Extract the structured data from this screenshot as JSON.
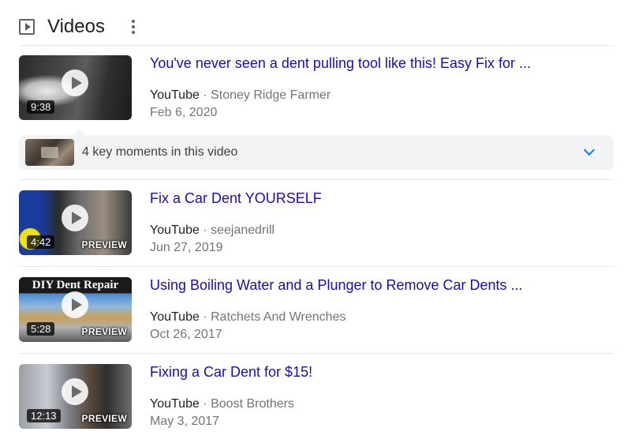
{
  "header": {
    "title": "Videos",
    "icon": "video-play-icon"
  },
  "key_moments": {
    "label": "4 key moments in this video",
    "accent": "#1a73e8"
  },
  "videos": [
    {
      "title": "You've never seen a dent pulling tool like this! Easy Fix for ...",
      "source": "YouTube",
      "separator": "·",
      "channel": "Stoney Ridge Farmer",
      "date": "Feb 6, 2020",
      "duration": "9:38",
      "preview": ""
    },
    {
      "title": "Fix a Car Dent YOURSELF",
      "source": "YouTube",
      "separator": "·",
      "channel": "seejanedrill",
      "date": "Jun 27, 2019",
      "duration": "4:42",
      "preview": "PREVIEW"
    },
    {
      "title": "Using Boiling Water and a Plunger to Remove Car Dents ...",
      "source": "YouTube",
      "separator": "·",
      "channel": "Ratchets And Wrenches",
      "date": "Oct 26, 2017",
      "duration": "5:28",
      "preview": "PREVIEW",
      "banner": "DIY Dent Repair"
    },
    {
      "title": "Fixing a Car Dent for $15!",
      "source": "YouTube",
      "separator": "·",
      "channel": "Boost Brothers",
      "date": "May 3, 2017",
      "duration": "12:13",
      "preview": "PREVIEW"
    }
  ],
  "colors": {
    "link": "#1a0dab",
    "meta": "#70757a",
    "panel": "#f1f3f4",
    "divider": "#e8eaed"
  }
}
